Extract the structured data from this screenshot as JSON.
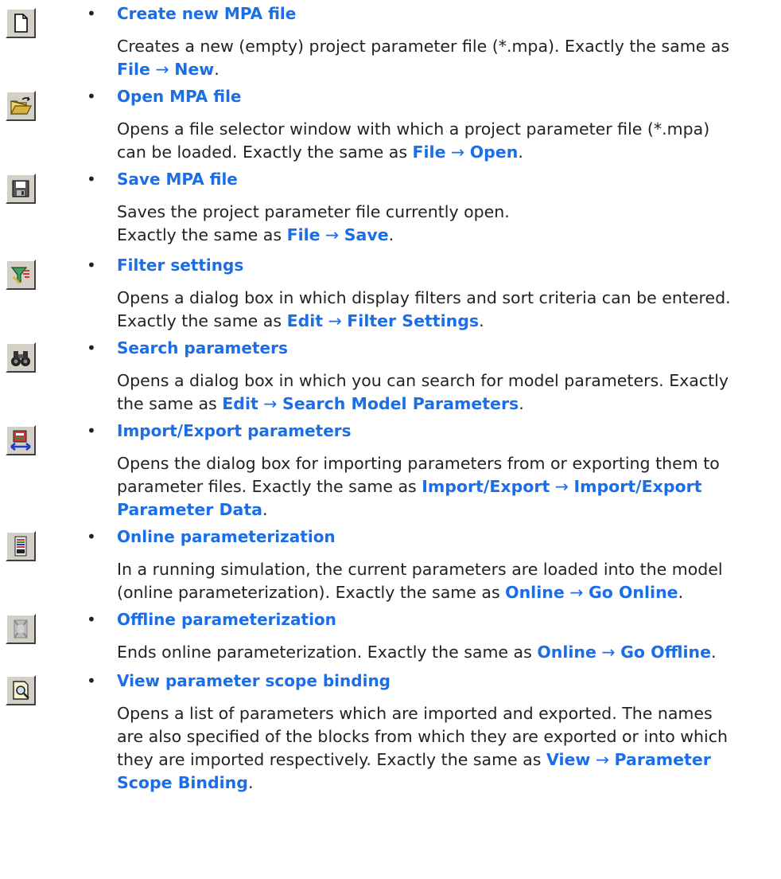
{
  "entries": [
    {
      "title": "Create new MPA file",
      "icon": "new-file-icon",
      "lines": [
        [
          {
            "t": "Creates a new (empty) project parameter file (*.mpa). Exactly the same as"
          }
        ],
        [
          {
            "t": "File",
            "b": true
          },
          {
            "t": " → ",
            "a": true
          },
          {
            "t": "New",
            "b": true
          },
          {
            "t": "."
          }
        ]
      ]
    },
    {
      "title": "Open MPA file",
      "icon": "open-folder-icon",
      "lines": [
        [
          {
            "t": "Opens a file selector window with which a project parameter file (*.mpa)"
          }
        ],
        [
          {
            "t": "can be loaded. Exactly the same as "
          },
          {
            "t": "File",
            "b": true
          },
          {
            "t": " → ",
            "a": true
          },
          {
            "t": "Open",
            "b": true
          },
          {
            "t": "."
          }
        ]
      ]
    },
    {
      "title": "Save MPA file",
      "icon": "save-disk-icon",
      "lines": [
        [
          {
            "t": "Saves the project parameter file currently open."
          }
        ],
        [
          {
            "t": "Exactly the same as "
          },
          {
            "t": "File",
            "b": true
          },
          {
            "t": " → ",
            "a": true
          },
          {
            "t": "Save",
            "b": true
          },
          {
            "t": "."
          }
        ]
      ]
    },
    {
      "title": "Filter settings",
      "icon": "filter-funnel-icon",
      "lines": [
        [
          {
            "t": "Opens a dialog box in which display filters and sort criteria can be entered."
          }
        ],
        [
          {
            "t": "Exactly the same as "
          },
          {
            "t": "Edit",
            "b": true
          },
          {
            "t": " → ",
            "a": true
          },
          {
            "t": "Filter Settings",
            "b": true
          },
          {
            "t": "."
          }
        ]
      ]
    },
    {
      "title": "Search parameters",
      "icon": "binoculars-icon",
      "lines": [
        [
          {
            "t": "Opens a dialog box in which you can search for model parameters. Exactly"
          }
        ],
        [
          {
            "t": "the same as "
          },
          {
            "t": "Edit",
            "b": true
          },
          {
            "t": " → ",
            "a": true
          },
          {
            "t": "Search Model Parameters",
            "b": true
          },
          {
            "t": "."
          }
        ]
      ]
    },
    {
      "title": "Import/Export parameters",
      "icon": "import-export-icon",
      "lines": [
        [
          {
            "t": "Opens the dialog box for importing parameters from or exporting them to"
          }
        ],
        [
          {
            "t": "parameter files. Exactly the same as "
          },
          {
            "t": "Import/Export",
            "b": true
          },
          {
            "t": " → ",
            "a": true
          },
          {
            "t": "Import/Export",
            "b": true
          }
        ],
        [
          {
            "t": "Parameter Data",
            "b": true
          },
          {
            "t": "."
          }
        ]
      ]
    },
    {
      "title": "Online parameterization",
      "icon": "online-device-icon",
      "lines": [
        [
          {
            "t": "In a running simulation, the current parameters are loaded into the model"
          }
        ],
        [
          {
            "t": "(online parameterization). Exactly the same as "
          },
          {
            "t": "Online",
            "b": true
          },
          {
            "t": " → ",
            "a": true
          },
          {
            "t": "Go Online",
            "b": true
          },
          {
            "t": "."
          }
        ]
      ]
    },
    {
      "title": "Offline parameterization",
      "icon": "offline-device-icon",
      "lines": [
        [
          {
            "t": "Ends online parameterization. Exactly the same as "
          },
          {
            "t": "Online",
            "b": true
          },
          {
            "t": " → ",
            "a": true
          },
          {
            "t": "Go Offline",
            "b": true
          },
          {
            "t": "."
          }
        ]
      ]
    },
    {
      "title": "View parameter scope binding",
      "icon": "scope-binding-icon",
      "lines": [
        [
          {
            "t": "Opens a list of parameters which are imported and exported. The names"
          }
        ],
        [
          {
            "t": "are also specified of the blocks from which they are exported or into which"
          }
        ],
        [
          {
            "t": "they are imported respectively. Exactly the same as "
          },
          {
            "t": "View",
            "b": true
          },
          {
            "t": " → ",
            "a": true
          },
          {
            "t": "Parameter",
            "b": true
          }
        ],
        [
          {
            "t": "Scope Binding",
            "b": true
          },
          {
            "t": "."
          }
        ]
      ]
    }
  ],
  "bullet": "•",
  "colors": {
    "link": "#1a6ee8",
    "text": "#222222",
    "button_face": "#d4d0c8"
  }
}
